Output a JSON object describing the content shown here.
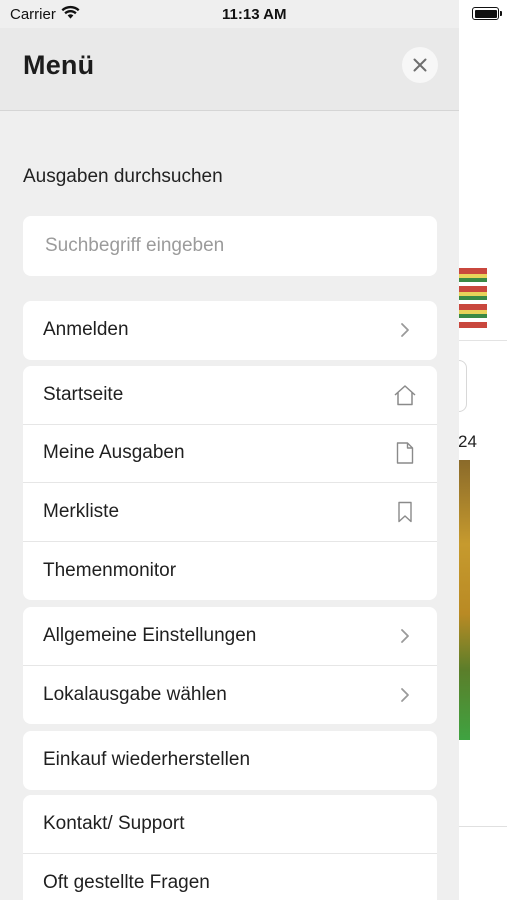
{
  "status_bar": {
    "carrier": "Carrier",
    "time": "11:13 AM"
  },
  "background": {
    "date_fragment": "24"
  },
  "menu": {
    "title": "Menü",
    "search": {
      "label": "Ausgaben durchsuchen",
      "placeholder": "Suchbegriff eingeben",
      "value": ""
    },
    "groups": [
      {
        "items": [
          {
            "label": "Anmelden",
            "icon": "chevron-right-icon"
          }
        ]
      },
      {
        "items": [
          {
            "label": "Startseite",
            "icon": "home-icon"
          },
          {
            "label": "Meine Ausgaben",
            "icon": "document-icon"
          },
          {
            "label": "Merkliste",
            "icon": "bookmark-icon"
          },
          {
            "label": "Themenmonitor",
            "icon": ""
          }
        ]
      },
      {
        "items": [
          {
            "label": "Allgemeine Einstellungen",
            "icon": "chevron-right-icon"
          },
          {
            "label": "Lokalausgabe wählen",
            "icon": "chevron-right-icon"
          }
        ]
      },
      {
        "items": [
          {
            "label": "Einkauf wiederherstellen",
            "icon": ""
          }
        ]
      },
      {
        "items": [
          {
            "label": "Kontakt/ Support",
            "icon": ""
          },
          {
            "label": "Oft gestellte Fragen",
            "icon": ""
          }
        ]
      }
    ]
  }
}
